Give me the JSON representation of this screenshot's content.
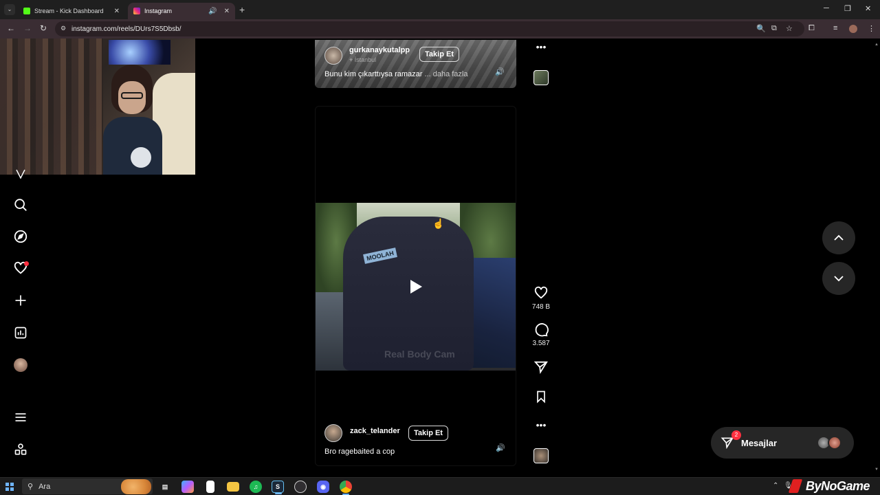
{
  "browser": {
    "tabs": [
      {
        "label": "Stream - Kick Dashboard",
        "favicon": "kick-icon",
        "color": "#53fc18"
      },
      {
        "label": "Instagram",
        "favicon": "instagram-icon",
        "color": "#e1306c"
      }
    ],
    "url": "instagram.com/reels/DUrs7S5Dbsb/"
  },
  "reels": {
    "top": {
      "username": "gurkanaykutalpp",
      "follow_label": "Takip Et",
      "location": "İstanbul",
      "caption": "Bunu kim çıkarttıysa ramazar",
      "more_label": "... daha fazla"
    },
    "main": {
      "username": "zack_telander",
      "follow_label": "Takip Et",
      "caption": "Bro ragebaited a cop",
      "watermark": "Real Body Cam",
      "shirt_text": "MOOLAH",
      "likes": "748 B",
      "comments": "3.587"
    }
  },
  "messages": {
    "label": "Mesajlar",
    "badge": "2"
  },
  "taskbar": {
    "search_placeholder": "Ara",
    "brand": "ByNoGame"
  },
  "colors": {
    "accent": "#0095f6",
    "notification": "#ff3040",
    "tab_active_bg": "#3a2d33"
  }
}
